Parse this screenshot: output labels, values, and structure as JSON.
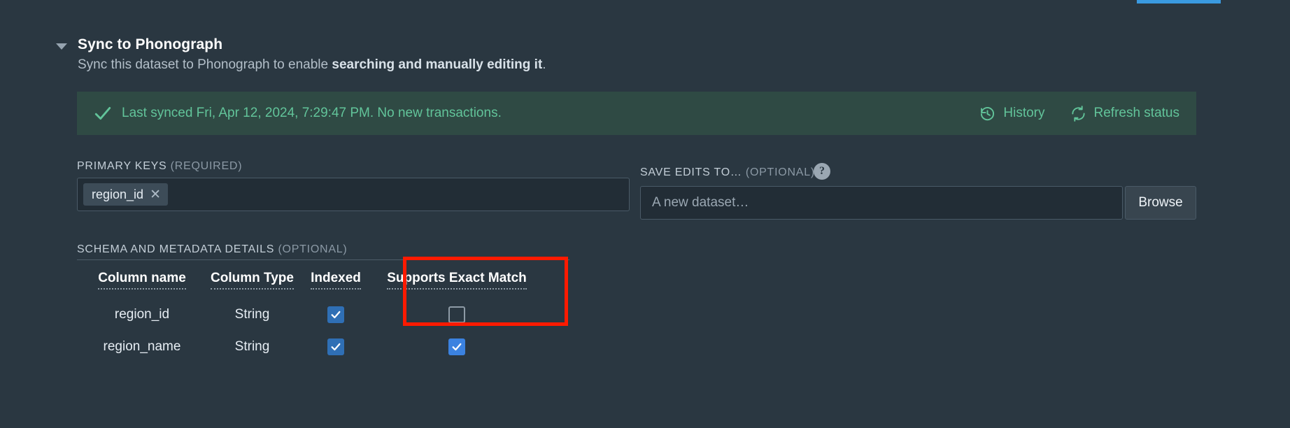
{
  "section": {
    "title": "Sync to Phonograph",
    "description_prefix": "Sync this dataset to Phonograph to enable ",
    "description_bold": "searching and manually editing it",
    "description_suffix": ".",
    "caret_icon": "caret-down-icon"
  },
  "banner": {
    "status_icon": "check-icon",
    "message": "Last synced Fri, Apr 12, 2024, 7:29:47 PM. No new transactions.",
    "history_label": "History",
    "history_icon": "history-icon",
    "refresh_label": "Refresh status",
    "refresh_icon": "refresh-icon",
    "background_color": "#2f4a44",
    "text_color": "#62c49a"
  },
  "primary_keys": {
    "label": "PRIMARY KEYS",
    "requirement": "(REQUIRED)",
    "chips": [
      {
        "value": "region_id",
        "remove_icon": "close-icon"
      }
    ]
  },
  "save_edits": {
    "label": "SAVE EDITS TO…",
    "requirement": "(OPTIONAL)",
    "help_icon": "help-icon",
    "help_glyph": "?",
    "input_value": "",
    "input_placeholder": "A new dataset…",
    "browse_label": "Browse"
  },
  "schema": {
    "label": "SCHEMA AND METADATA DETAILS",
    "requirement": "(OPTIONAL)",
    "columns": [
      "Column name",
      "Column Type",
      "Indexed",
      "Supports Exact Match"
    ],
    "rows": [
      {
        "name": "region_id",
        "type": "String",
        "indexed": true,
        "exact_match": false
      },
      {
        "name": "region_name",
        "type": "String",
        "indexed": true,
        "exact_match": true
      }
    ]
  },
  "annotation": {
    "target_column": "Supports Exact Match",
    "color": "#ff1a00"
  },
  "theme": {
    "background": "#2a3741",
    "accent_blue": "#3b82e0",
    "top_bar_color": "#3a9ae0"
  }
}
